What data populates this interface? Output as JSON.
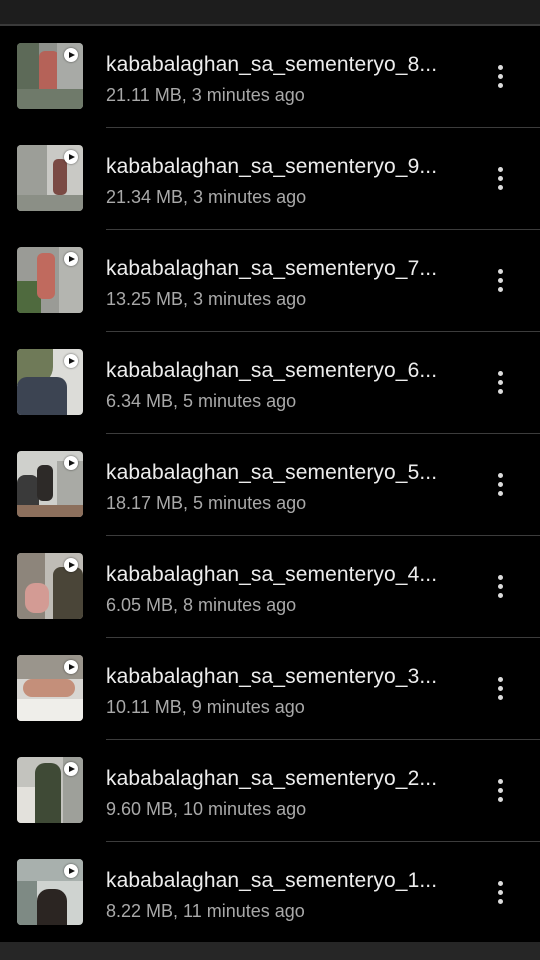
{
  "files": [
    {
      "name": "kababalaghan_sa_sementeryo_8...",
      "meta": "21.11 MB, 3 minutes ago",
      "thumb_icon": "video-thumbnail",
      "action_icon": "more-vert-icon"
    },
    {
      "name": "kababalaghan_sa_sementeryo_9...",
      "meta": "21.34 MB, 3 minutes ago",
      "thumb_icon": "video-thumbnail",
      "action_icon": "more-vert-icon"
    },
    {
      "name": "kababalaghan_sa_sementeryo_7...",
      "meta": "13.25 MB, 3 minutes ago",
      "thumb_icon": "video-thumbnail",
      "action_icon": "more-vert-icon"
    },
    {
      "name": "kababalaghan_sa_sementeryo_6...",
      "meta": "6.34 MB, 5 minutes ago",
      "thumb_icon": "video-thumbnail",
      "action_icon": "more-vert-icon"
    },
    {
      "name": "kababalaghan_sa_sementeryo_5...",
      "meta": "18.17 MB, 5 minutes ago",
      "thumb_icon": "video-thumbnail",
      "action_icon": "more-vert-icon"
    },
    {
      "name": "kababalaghan_sa_sementeryo_4...",
      "meta": "6.05 MB, 8 minutes ago",
      "thumb_icon": "video-thumbnail",
      "action_icon": "more-vert-icon"
    },
    {
      "name": "kababalaghan_sa_sementeryo_3...",
      "meta": "10.11 MB, 9 minutes ago",
      "thumb_icon": "video-thumbnail",
      "action_icon": "more-vert-icon"
    },
    {
      "name": "kababalaghan_sa_sementeryo_2...",
      "meta": "9.60 MB, 10 minutes ago",
      "thumb_icon": "video-thumbnail",
      "action_icon": "more-vert-icon"
    },
    {
      "name": "kababalaghan_sa_sementeryo_1...",
      "meta": "8.22 MB, 11 minutes ago",
      "thumb_icon": "video-thumbnail",
      "action_icon": "more-vert-icon"
    }
  ],
  "colors": {
    "background": "#000000",
    "title_text": "#ededed",
    "meta_text": "#a9a9a9",
    "divider": "#3c3c3c",
    "play_badge": "#ffffff"
  }
}
